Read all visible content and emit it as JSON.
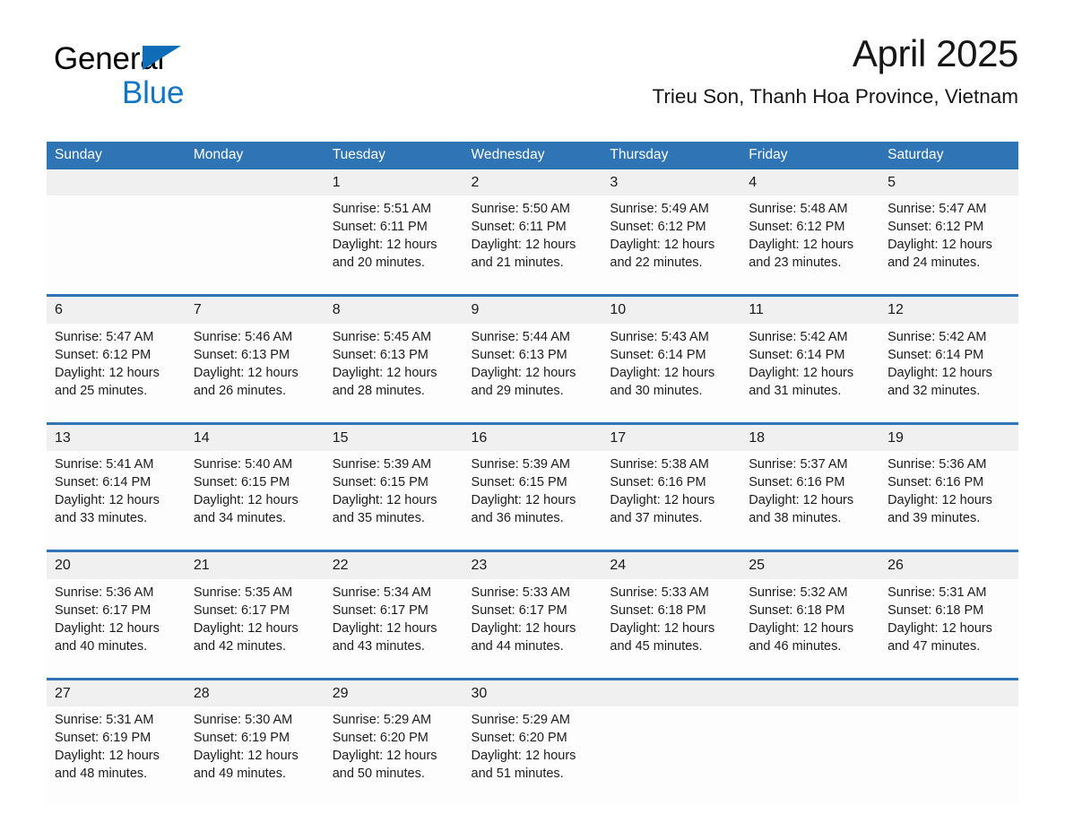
{
  "brand": {
    "name_part1": "General",
    "name_part2": "Blue",
    "triangle_color": "#0f6cb6",
    "blue_color": "#1275c4"
  },
  "header": {
    "title": "April 2025",
    "subtitle": "Trieu Son, Thanh Hoa Province, Vietnam"
  },
  "theme": {
    "header_blue": "#2f74b5",
    "daynum_band": "#f0f0f0",
    "cell_bg": "#fdfdfd",
    "text": "#1a1a1a"
  },
  "weekdays": [
    "Sunday",
    "Monday",
    "Tuesday",
    "Wednesday",
    "Thursday",
    "Friday",
    "Saturday"
  ],
  "weeks": [
    [
      {
        "day": "",
        "lines": [
          "",
          "",
          "",
          ""
        ]
      },
      {
        "day": "",
        "lines": [
          "",
          "",
          "",
          ""
        ]
      },
      {
        "day": "1",
        "lines": [
          "Sunrise: 5:51 AM",
          "Sunset: 6:11 PM",
          "Daylight: 12 hours",
          "and 20 minutes."
        ]
      },
      {
        "day": "2",
        "lines": [
          "Sunrise: 5:50 AM",
          "Sunset: 6:11 PM",
          "Daylight: 12 hours",
          "and 21 minutes."
        ]
      },
      {
        "day": "3",
        "lines": [
          "Sunrise: 5:49 AM",
          "Sunset: 6:12 PM",
          "Daylight: 12 hours",
          "and 22 minutes."
        ]
      },
      {
        "day": "4",
        "lines": [
          "Sunrise: 5:48 AM",
          "Sunset: 6:12 PM",
          "Daylight: 12 hours",
          "and 23 minutes."
        ]
      },
      {
        "day": "5",
        "lines": [
          "Sunrise: 5:47 AM",
          "Sunset: 6:12 PM",
          "Daylight: 12 hours",
          "and 24 minutes."
        ]
      }
    ],
    [
      {
        "day": "6",
        "lines": [
          "Sunrise: 5:47 AM",
          "Sunset: 6:12 PM",
          "Daylight: 12 hours",
          "and 25 minutes."
        ]
      },
      {
        "day": "7",
        "lines": [
          "Sunrise: 5:46 AM",
          "Sunset: 6:13 PM",
          "Daylight: 12 hours",
          "and 26 minutes."
        ]
      },
      {
        "day": "8",
        "lines": [
          "Sunrise: 5:45 AM",
          "Sunset: 6:13 PM",
          "Daylight: 12 hours",
          "and 28 minutes."
        ]
      },
      {
        "day": "9",
        "lines": [
          "Sunrise: 5:44 AM",
          "Sunset: 6:13 PM",
          "Daylight: 12 hours",
          "and 29 minutes."
        ]
      },
      {
        "day": "10",
        "lines": [
          "Sunrise: 5:43 AM",
          "Sunset: 6:14 PM",
          "Daylight: 12 hours",
          "and 30 minutes."
        ]
      },
      {
        "day": "11",
        "lines": [
          "Sunrise: 5:42 AM",
          "Sunset: 6:14 PM",
          "Daylight: 12 hours",
          "and 31 minutes."
        ]
      },
      {
        "day": "12",
        "lines": [
          "Sunrise: 5:42 AM",
          "Sunset: 6:14 PM",
          "Daylight: 12 hours",
          "and 32 minutes."
        ]
      }
    ],
    [
      {
        "day": "13",
        "lines": [
          "Sunrise: 5:41 AM",
          "Sunset: 6:14 PM",
          "Daylight: 12 hours",
          "and 33 minutes."
        ]
      },
      {
        "day": "14",
        "lines": [
          "Sunrise: 5:40 AM",
          "Sunset: 6:15 PM",
          "Daylight: 12 hours",
          "and 34 minutes."
        ]
      },
      {
        "day": "15",
        "lines": [
          "Sunrise: 5:39 AM",
          "Sunset: 6:15 PM",
          "Daylight: 12 hours",
          "and 35 minutes."
        ]
      },
      {
        "day": "16",
        "lines": [
          "Sunrise: 5:39 AM",
          "Sunset: 6:15 PM",
          "Daylight: 12 hours",
          "and 36 minutes."
        ]
      },
      {
        "day": "17",
        "lines": [
          "Sunrise: 5:38 AM",
          "Sunset: 6:16 PM",
          "Daylight: 12 hours",
          "and 37 minutes."
        ]
      },
      {
        "day": "18",
        "lines": [
          "Sunrise: 5:37 AM",
          "Sunset: 6:16 PM",
          "Daylight: 12 hours",
          "and 38 minutes."
        ]
      },
      {
        "day": "19",
        "lines": [
          "Sunrise: 5:36 AM",
          "Sunset: 6:16 PM",
          "Daylight: 12 hours",
          "and 39 minutes."
        ]
      }
    ],
    [
      {
        "day": "20",
        "lines": [
          "Sunrise: 5:36 AM",
          "Sunset: 6:17 PM",
          "Daylight: 12 hours",
          "and 40 minutes."
        ]
      },
      {
        "day": "21",
        "lines": [
          "Sunrise: 5:35 AM",
          "Sunset: 6:17 PM",
          "Daylight: 12 hours",
          "and 42 minutes."
        ]
      },
      {
        "day": "22",
        "lines": [
          "Sunrise: 5:34 AM",
          "Sunset: 6:17 PM",
          "Daylight: 12 hours",
          "and 43 minutes."
        ]
      },
      {
        "day": "23",
        "lines": [
          "Sunrise: 5:33 AM",
          "Sunset: 6:17 PM",
          "Daylight: 12 hours",
          "and 44 minutes."
        ]
      },
      {
        "day": "24",
        "lines": [
          "Sunrise: 5:33 AM",
          "Sunset: 6:18 PM",
          "Daylight: 12 hours",
          "and 45 minutes."
        ]
      },
      {
        "day": "25",
        "lines": [
          "Sunrise: 5:32 AM",
          "Sunset: 6:18 PM",
          "Daylight: 12 hours",
          "and 46 minutes."
        ]
      },
      {
        "day": "26",
        "lines": [
          "Sunrise: 5:31 AM",
          "Sunset: 6:18 PM",
          "Daylight: 12 hours",
          "and 47 minutes."
        ]
      }
    ],
    [
      {
        "day": "27",
        "lines": [
          "Sunrise: 5:31 AM",
          "Sunset: 6:19 PM",
          "Daylight: 12 hours",
          "and 48 minutes."
        ]
      },
      {
        "day": "28",
        "lines": [
          "Sunrise: 5:30 AM",
          "Sunset: 6:19 PM",
          "Daylight: 12 hours",
          "and 49 minutes."
        ]
      },
      {
        "day": "29",
        "lines": [
          "Sunrise: 5:29 AM",
          "Sunset: 6:20 PM",
          "Daylight: 12 hours",
          "and 50 minutes."
        ]
      },
      {
        "day": "30",
        "lines": [
          "Sunrise: 5:29 AM",
          "Sunset: 6:20 PM",
          "Daylight: 12 hours",
          "and 51 minutes."
        ]
      },
      {
        "day": "",
        "lines": [
          "",
          "",
          "",
          ""
        ]
      },
      {
        "day": "",
        "lines": [
          "",
          "",
          "",
          ""
        ]
      },
      {
        "day": "",
        "lines": [
          "",
          "",
          "",
          ""
        ]
      }
    ]
  ]
}
